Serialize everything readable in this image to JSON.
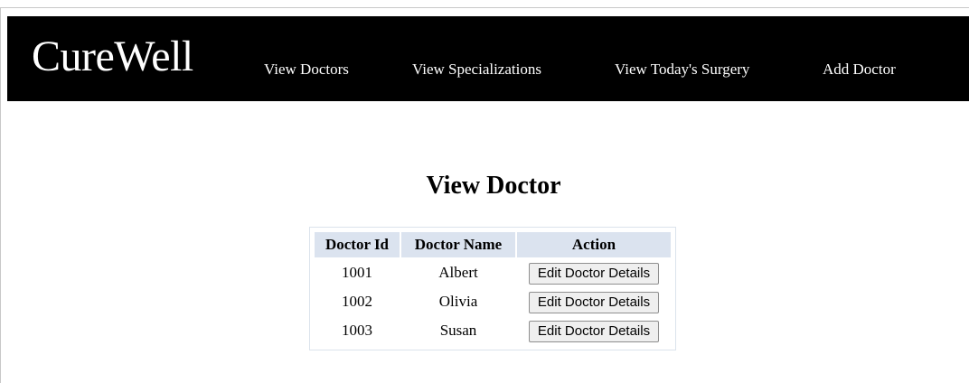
{
  "app": {
    "brand": "CureWell"
  },
  "nav": {
    "items": [
      {
        "label": "View Doctors"
      },
      {
        "label": "View Specializations"
      },
      {
        "label": "View Today's Surgery"
      },
      {
        "label": "Add Doctor"
      }
    ]
  },
  "page": {
    "title": "View Doctor"
  },
  "table": {
    "headers": [
      "Doctor Id",
      "Doctor Name",
      "Action"
    ],
    "rows": [
      {
        "id": "1001",
        "name": "Albert",
        "action": "Edit Doctor Details"
      },
      {
        "id": "1002",
        "name": "Olivia",
        "action": "Edit Doctor Details"
      },
      {
        "id": "1003",
        "name": "Susan",
        "action": "Edit Doctor Details"
      }
    ]
  }
}
